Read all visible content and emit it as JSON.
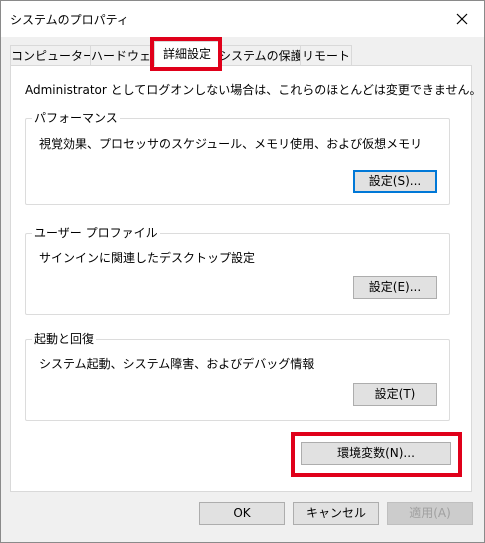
{
  "window": {
    "title": "システムのプロパティ"
  },
  "tabs": [
    {
      "label": "コンピューター名",
      "active": false
    },
    {
      "label": "ハードウェア",
      "active": false
    },
    {
      "label": "詳細設定",
      "active": true
    },
    {
      "label": "システムの保護",
      "active": false
    },
    {
      "label": "リモート",
      "active": false
    }
  ],
  "intro_text": "Administrator としてログオンしない場合は、これらのほとんどは変更できません。",
  "performance": {
    "title": "パフォーマンス",
    "description": "視覚効果、プロセッサのスケジュール、メモリ使用、および仮想メモリ",
    "button_label": "設定(S)..."
  },
  "user_profiles": {
    "title": "ユーザー プロファイル",
    "description": "サインインに関連したデスクトップ設定",
    "button_label": "設定(E)..."
  },
  "startup_recovery": {
    "title": "起動と回復",
    "description": "システム起動、システム障害、およびデバッグ情報",
    "button_label": "設定(T)"
  },
  "env_vars_button_label": "環境変数(N)...",
  "footer": {
    "ok_label": "OK",
    "cancel_label": "キャンセル",
    "apply_label": "適用(A)"
  },
  "colors": {
    "highlight": "#e0001a",
    "focus_border": "#0078d7"
  },
  "icons": {
    "close": "close-icon"
  }
}
